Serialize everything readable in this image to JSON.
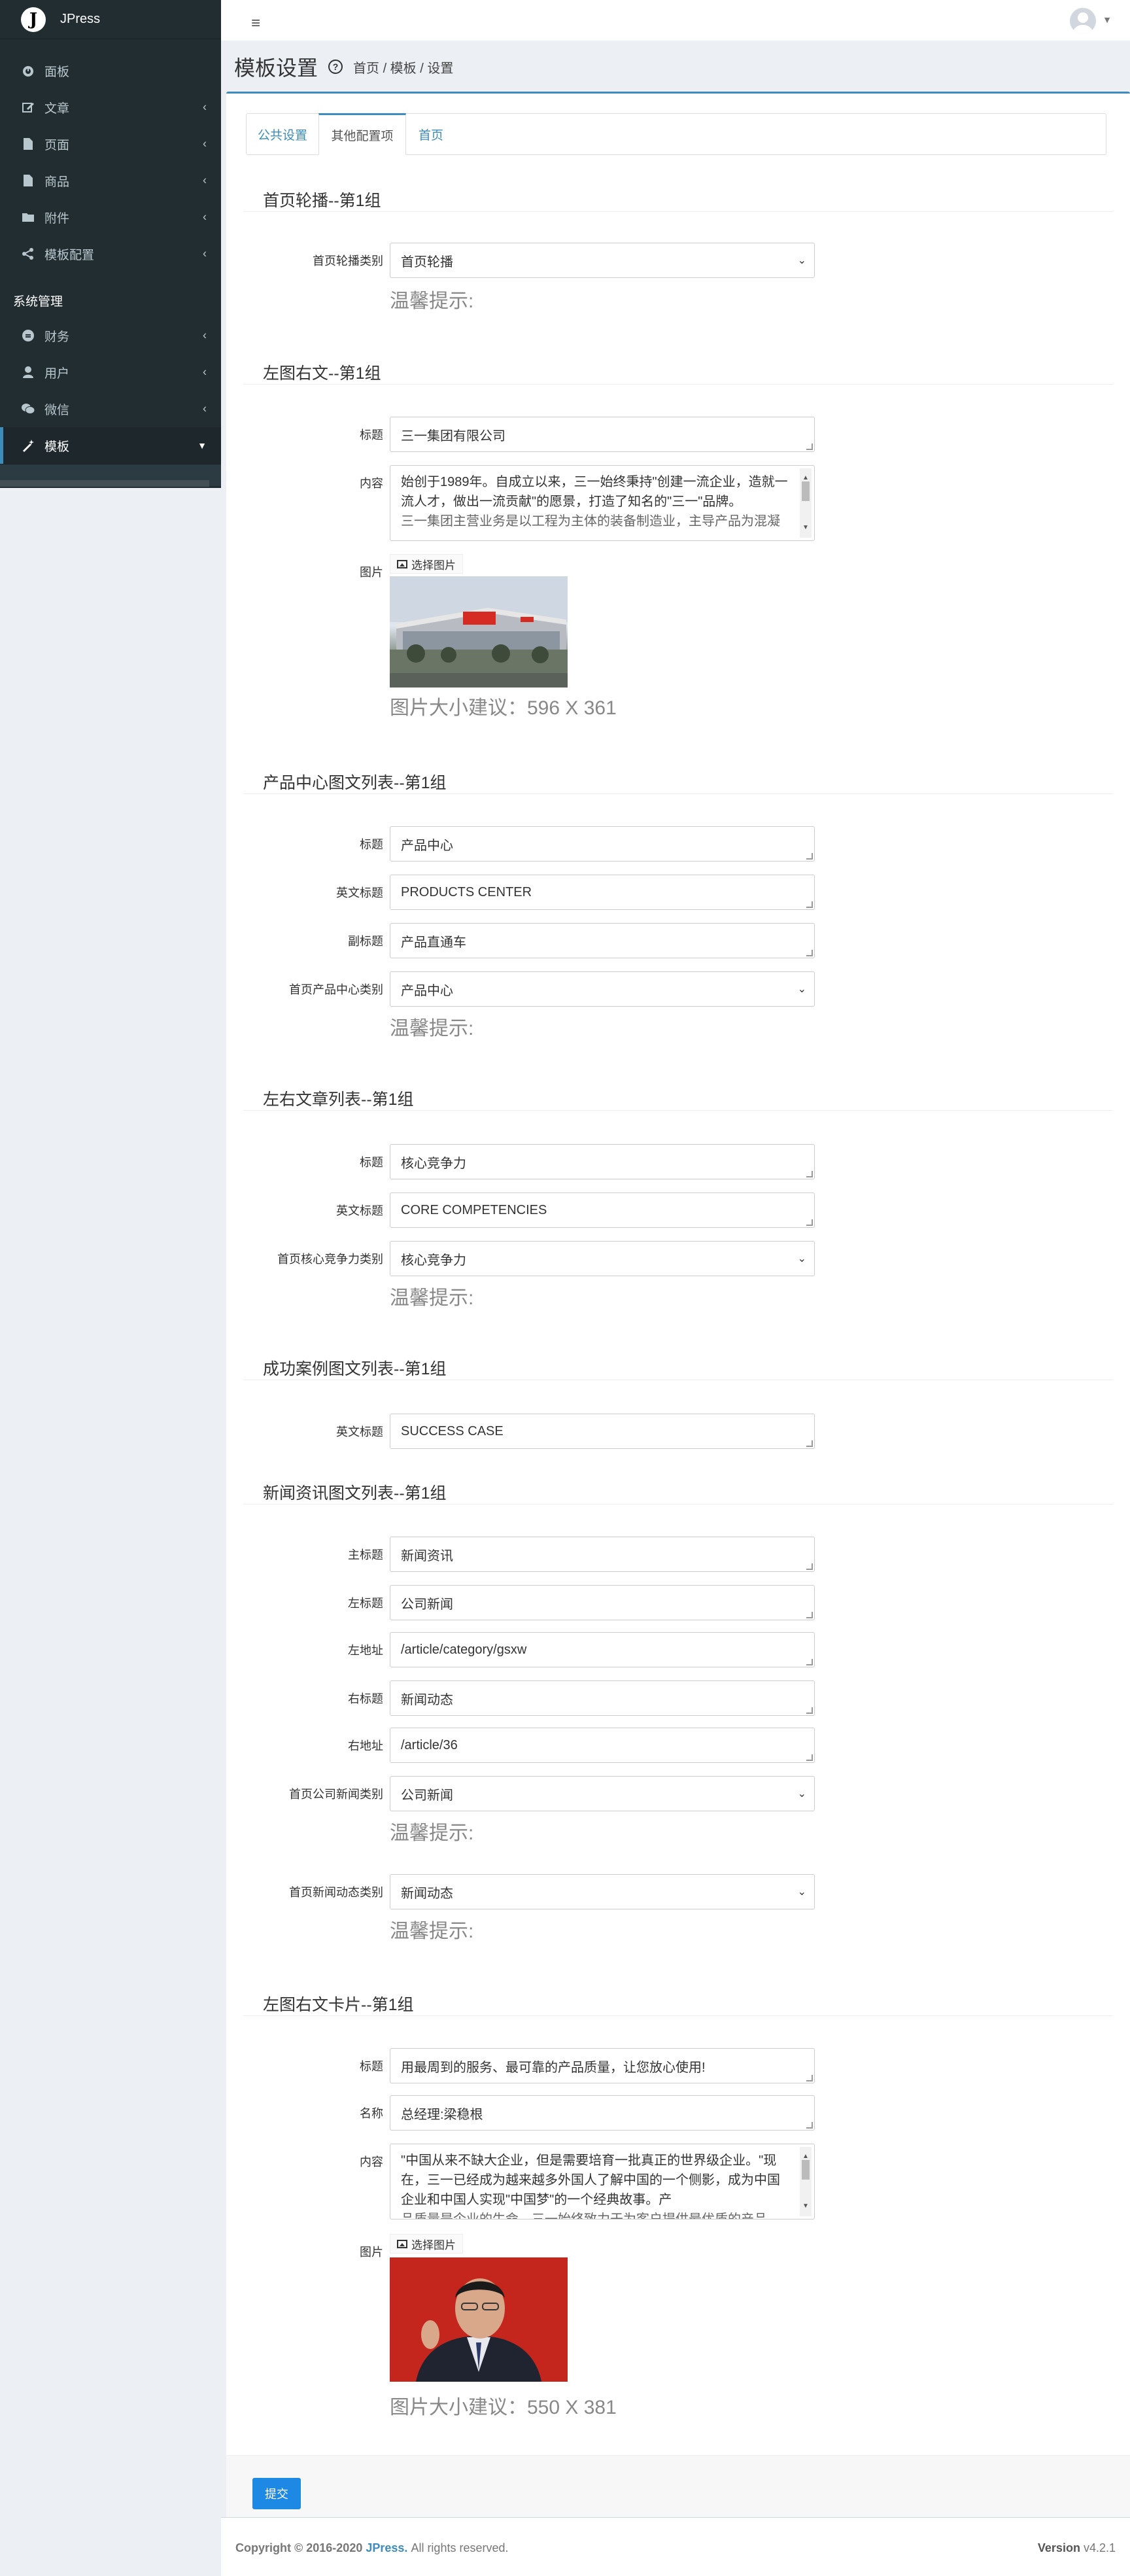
{
  "app": {
    "logo_letter": "J",
    "name": "JPress"
  },
  "sidebar": {
    "items": [
      {
        "label": "面板",
        "icon": "dashboard-icon",
        "has_chevron": false
      },
      {
        "label": "文章",
        "icon": "edit-icon",
        "has_chevron": true
      },
      {
        "label": "页面",
        "icon": "file-icon",
        "has_chevron": true
      },
      {
        "label": "商品",
        "icon": "file-icon",
        "has_chevron": true
      },
      {
        "label": "附件",
        "icon": "folder-icon",
        "has_chevron": true
      },
      {
        "label": "模板配置",
        "icon": "share-icon",
        "has_chevron": true
      }
    ],
    "section_header": "系统管理",
    "system_items": [
      {
        "label": "财务",
        "icon": "coin-icon",
        "has_chevron": true
      },
      {
        "label": "用户",
        "icon": "user-icon",
        "has_chevron": true
      },
      {
        "label": "微信",
        "icon": "wechat-icon",
        "has_chevron": true
      },
      {
        "label": "模板",
        "icon": "magic-icon",
        "has_chevron": true,
        "active": true
      }
    ]
  },
  "header": {
    "title": "模板设置",
    "breadcrumb": "首页 / 模板 / 设置"
  },
  "tabs": [
    "公共设置",
    "其他配置项",
    "首页"
  ],
  "sections": {
    "carousel": {
      "title": "首页轮播--第1组",
      "type_label": "首页轮播类别",
      "type_value": "首页轮播",
      "hint": "温馨提示:"
    },
    "left_image": {
      "title": "左图右文--第1组",
      "title_label": "标题",
      "title_value": "三一集团有限公司",
      "content_label": "内容",
      "content_value": "始创于1989年。自成立以来，三一始终秉持\"创建一流企业，造就一流人才，做出一流贡献\"的愿景，打造了知名的\"三一\"品牌。",
      "content_cut": "三一集团主营业务是以工程为主体的装备制造业，主导产品为混凝",
      "image_label": "图片",
      "choose_button": "选择图片",
      "size_hint": "图片大小建议：596 X 361"
    },
    "products": {
      "title": "产品中心图文列表--第1组",
      "title_label": "标题",
      "title_value": "产品中心",
      "en_label": "英文标题",
      "en_value": "PRODUCTS CENTER",
      "sub_label": "副标题",
      "sub_value": "产品直通车",
      "type_label": "首页产品中心类别",
      "type_value": "产品中心",
      "hint": "温馨提示:"
    },
    "articles": {
      "title": "左右文章列表--第1组",
      "title_label": "标题",
      "title_value": "核心竞争力",
      "en_label": "英文标题",
      "en_value": "CORE COMPETENCIES",
      "type_label": "首页核心竞争力类别",
      "type_value": "核心竞争力",
      "hint": "温馨提示:"
    },
    "cases": {
      "title": "成功案例图文列表--第1组",
      "en_label": "英文标题",
      "en_value": "SUCCESS CASE"
    },
    "news": {
      "title": "新闻资讯图文列表--第1组",
      "main_label": "主标题",
      "main_value": "新闻资讯",
      "left_title_label": "左标题",
      "left_title_value": "公司新闻",
      "left_url_label": "左地址",
      "left_url_value": "/article/category/gsxw",
      "right_title_label": "右标题",
      "right_title_value": "新闻动态",
      "right_url_label": "右地址",
      "right_url_value": "/article/36",
      "company_type_label": "首页公司新闻类别",
      "company_type_value": "公司新闻",
      "hint1": "温馨提示:",
      "dynamic_type_label": "首页新闻动态类别",
      "dynamic_type_value": "新闻动态",
      "hint2": "温馨提示:"
    },
    "card": {
      "title": "左图右文卡片--第1组",
      "title_label": "标题",
      "title_value": "用最周到的服务、最可靠的产品质量，让您放心使用!",
      "name_label": "名称",
      "name_value": "总经理:梁稳根",
      "content_label": "内容",
      "content_value": "\"中国从来不缺大企业，但是需要培育一批真正的世界级企业。\"现在，三一已经成为越来越多外国人了解中国的一个侧影，成为中国企业和中国人实现\"中国梦\"的一个经典故事。产",
      "content_cut": "品质量是企业的生命，三一始终致力于为客户提供最优质的产品",
      "image_label": "图片",
      "choose_button": "选择图片",
      "size_hint": "图片大小建议：550 X 381"
    }
  },
  "submit_label": "提交",
  "footer": {
    "copyright": "Copyright © 2016-2020",
    "brand": "JPress.",
    "rights": "All rights reserved.",
    "version_label": "Version",
    "version_value": "v4.2.1"
  }
}
